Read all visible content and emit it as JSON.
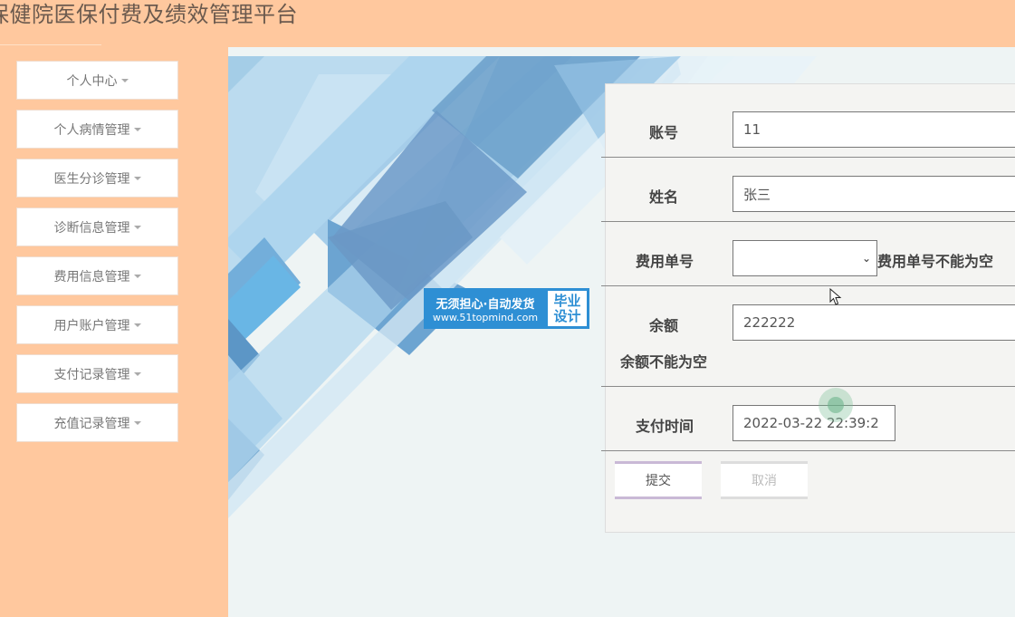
{
  "header": {
    "title": "保健院医保付费及绩效管理平台"
  },
  "sidebar": {
    "items": [
      {
        "label": "个人中心"
      },
      {
        "label": "个人病情管理"
      },
      {
        "label": "医生分诊管理"
      },
      {
        "label": "诊断信息管理"
      },
      {
        "label": "费用信息管理"
      },
      {
        "label": "用户账户管理"
      },
      {
        "label": "支付记录管理"
      },
      {
        "label": "充值记录管理"
      }
    ]
  },
  "watermark": {
    "line1": "无须担心·自动发货",
    "line2": "www.51topmind.com",
    "badge1": "毕业",
    "badge2": "设计"
  },
  "form": {
    "account_label": "账号",
    "account_value": "11",
    "name_label": "姓名",
    "name_value": "张三",
    "fee_no_label": "费用单号",
    "fee_no_value": "",
    "fee_no_error": "费用单号不能为空",
    "balance_label": "余额",
    "balance_value": "222222",
    "balance_error": "余额不能为空",
    "pay_time_label": "支付时间",
    "pay_time_value": "2022-03-22 22:39:2",
    "submit_label": "提交",
    "cancel_label": "取消"
  },
  "colors": {
    "accent": "#ffc89e",
    "watermark_blue": "#2e8fd4"
  }
}
